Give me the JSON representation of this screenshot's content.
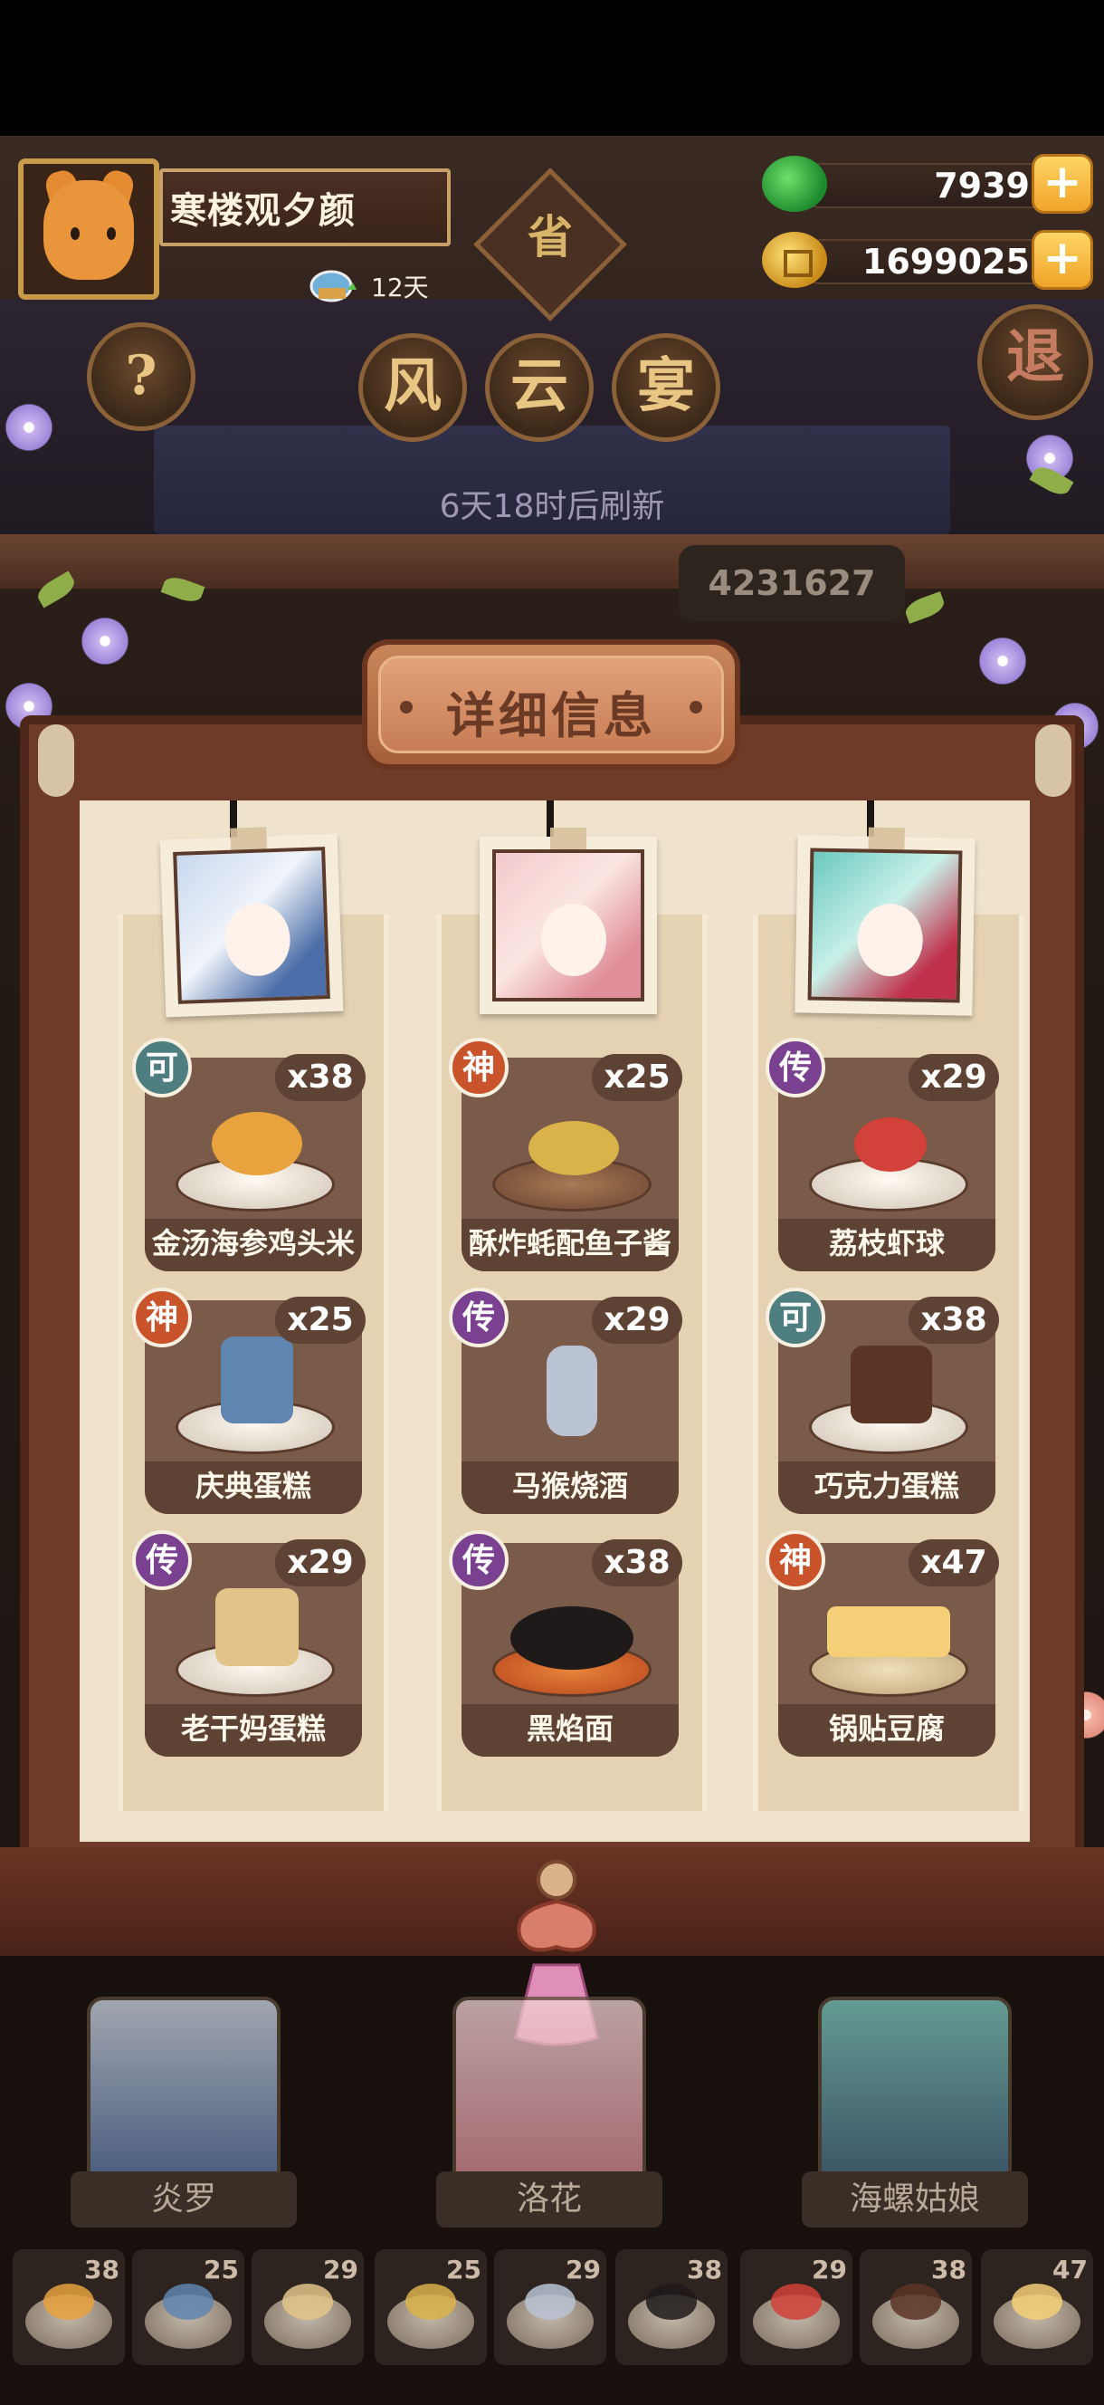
{
  "player": {
    "name": "寒楼观夕颜",
    "vip_days": "12天"
  },
  "currency": [
    {
      "icon": "jade-icon",
      "value": "7939"
    },
    {
      "icon": "coin-icon",
      "value": "1699025"
    }
  ],
  "nav": {
    "help": "?",
    "province": "省",
    "title_chars": [
      "风",
      "云",
      "宴"
    ],
    "exit": "退"
  },
  "refresh_text": "6天18时后刷新",
  "score_partial": "4231627",
  "panel_title": "详细信息",
  "dishes": [
    {
      "name": "金汤海参鸡头米",
      "count": "x38",
      "grade": "可"
    },
    {
      "name": "酥炸蚝配鱼子酱",
      "count": "x25",
      "grade": "神"
    },
    {
      "name": "荔枝虾球",
      "count": "x29",
      "grade": "传"
    },
    {
      "name": "庆典蛋糕",
      "count": "x25",
      "grade": "神"
    },
    {
      "name": "马猴烧酒",
      "count": "x29",
      "grade": "传"
    },
    {
      "name": "巧克力蛋糕",
      "count": "x38",
      "grade": "可"
    },
    {
      "name": "老干妈蛋糕",
      "count": "x29",
      "grade": "传"
    },
    {
      "name": "黑焰面",
      "count": "x38",
      "grade": "传"
    },
    {
      "name": "锅贴豆腐",
      "count": "x47",
      "grade": "神"
    }
  ],
  "chefs": [
    "炎罗",
    "洛花",
    "海螺姑娘"
  ],
  "strip_counts": [
    "38",
    "25",
    "29",
    "25",
    "29",
    "38",
    "29",
    "38",
    "47"
  ],
  "colors": {
    "grade_ke": "#4f7e80",
    "grade_shen": "#c9542b",
    "grade_chuan": "#7a4190",
    "plus_button": "#f0a42a"
  }
}
